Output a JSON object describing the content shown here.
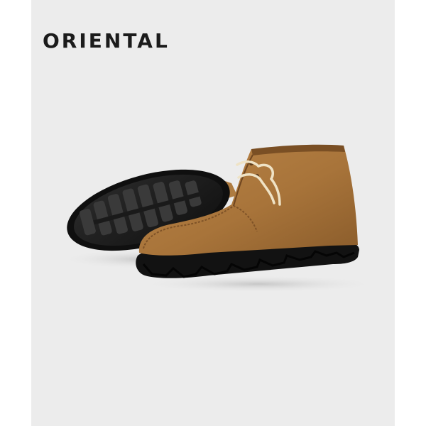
{
  "brand": {
    "logo_text": "ORIENTAL"
  },
  "colors": {
    "background": "#ececec",
    "suede": "#a8753a",
    "sole": "#1a1a1a",
    "laces": "#efe3c6"
  },
  "product_image": {
    "icon": "suede-chukka-boot-icon"
  }
}
